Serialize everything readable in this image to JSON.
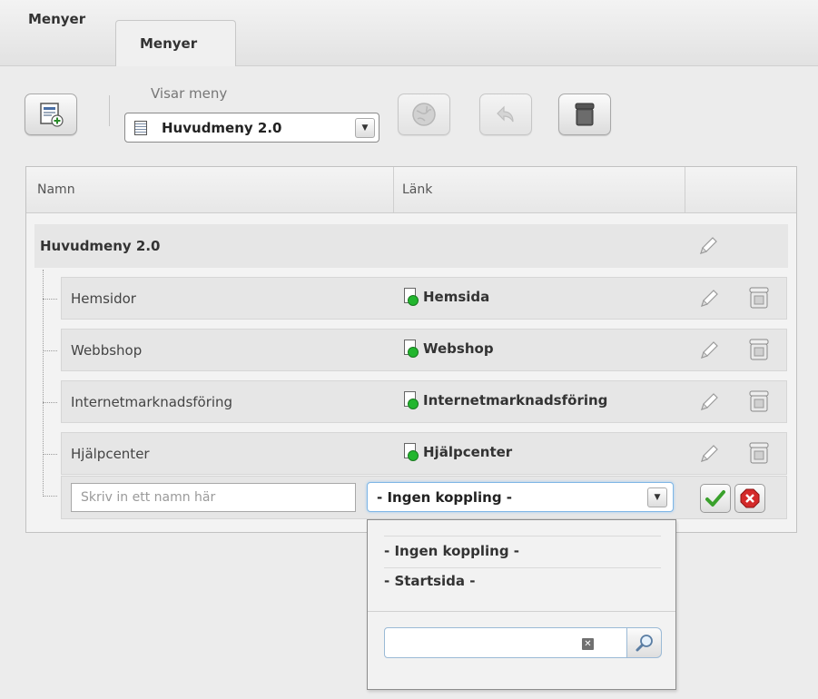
{
  "tabs": {
    "static_label": "Menyer",
    "active_label": "Menyer"
  },
  "toolbar": {
    "new_menu_icon": "new-menu-icon",
    "showing_label": "Visar meny",
    "selected_menu": "Huvudmeny 2.0",
    "disabled_buttons": [
      "globe-icon",
      "undo-icon"
    ],
    "delete_icon": "trash-icon"
  },
  "table": {
    "columns": [
      "Namn",
      "Länk"
    ],
    "root": {
      "name": "Huvudmeny 2.0"
    },
    "rows": [
      {
        "name": "Hemsidor",
        "link": "Hemsida"
      },
      {
        "name": "Webbshop",
        "link": "Webshop"
      },
      {
        "name": "Internetmarknadsföring",
        "link": "Internetmarknadsföring"
      },
      {
        "name": "Hjälpcenter",
        "link": "Hjälpcenter"
      }
    ],
    "new_row": {
      "name_placeholder": "Skriv in ett namn här",
      "name_value": "",
      "link_selected": "- Ingen koppling -"
    }
  },
  "dropdown": {
    "options": [
      "- Ingen koppling -",
      "- Startsida -"
    ],
    "search_value": ""
  },
  "colors": {
    "page_icon_dot": "#22b62e",
    "confirm_green": "#3aa12c",
    "cancel_red": "#d42a2a",
    "focus_blue": "#7fb6e6"
  }
}
